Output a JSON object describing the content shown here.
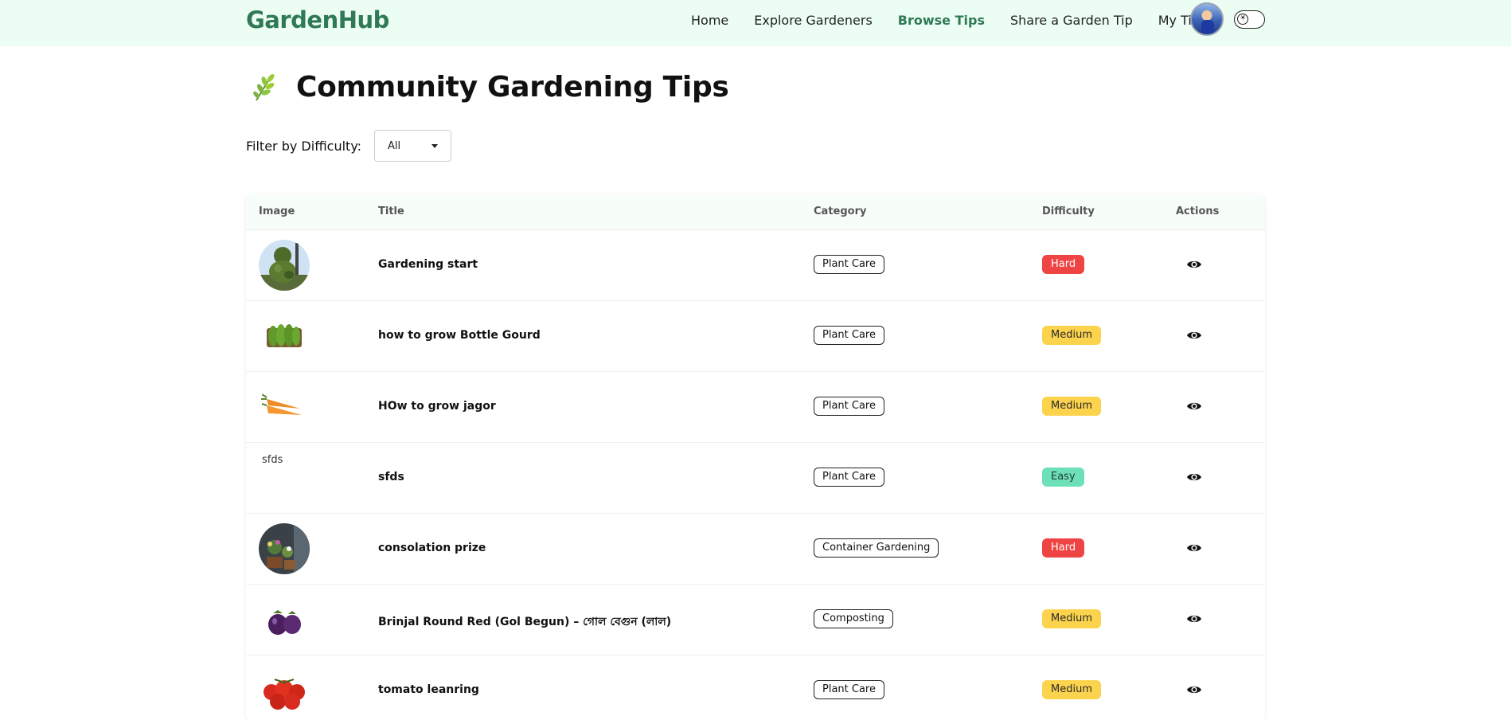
{
  "nav": {
    "brand": "GardenHub",
    "links": [
      {
        "label": "Home",
        "active": false
      },
      {
        "label": "Explore Gardeners",
        "active": false
      },
      {
        "label": "Browse Tips",
        "active": true
      },
      {
        "label": "Share a Garden Tip",
        "active": false
      },
      {
        "label": "My Tips",
        "active": false
      }
    ]
  },
  "page": {
    "title": "Community Gardening Tips",
    "title_icon": "leaf-icon"
  },
  "filter": {
    "label": "Filter by Difficulty:",
    "selected": "All"
  },
  "table": {
    "columns": [
      "Image",
      "Title",
      "Category",
      "Difficulty",
      "Actions"
    ],
    "rows": [
      {
        "image": "topiary-photo",
        "title": "Gardening start",
        "category": "Plant Care",
        "difficulty": "Hard"
      },
      {
        "image": "bottle-gourd-photo",
        "title": "how to grow Bottle Gourd",
        "category": "Plant Care",
        "difficulty": "Medium"
      },
      {
        "image": "carrot-photo",
        "title": "HOw to grow jagor",
        "category": "Plant Care",
        "difficulty": "Medium"
      },
      {
        "image": "broken-image",
        "image_alt": "sfds",
        "title": "sfds",
        "category": "Plant Care",
        "difficulty": "Easy"
      },
      {
        "image": "flower-pots-photo",
        "title": "consolation prize",
        "category": "Container Gardening",
        "difficulty": "Hard"
      },
      {
        "image": "brinjal-photo",
        "title": "Brinjal Round Red (Gol Begun) – গোল বেগুন (লাল)",
        "category": "Composting",
        "difficulty": "Medium"
      },
      {
        "image": "tomato-photo",
        "title": "tomato leanring",
        "category": "Plant Care",
        "difficulty": "Medium"
      }
    ]
  },
  "colors": {
    "brand": "#2f7a55",
    "navbar_bg": "#ecfdf3",
    "hard": "#ef4444",
    "medium": "#fcd34d",
    "easy": "#6ee0b7"
  }
}
